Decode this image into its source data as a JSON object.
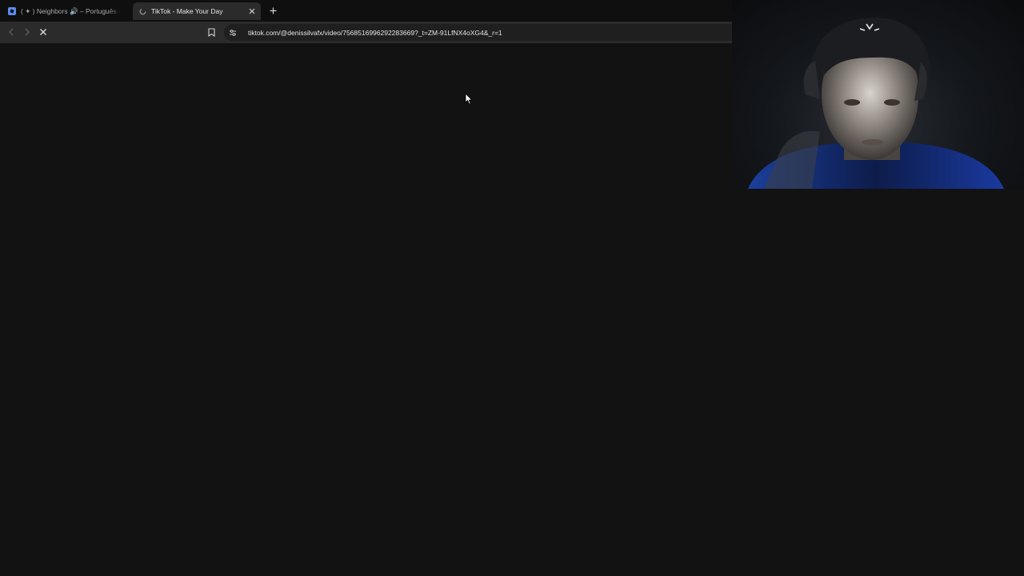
{
  "browser": {
    "tabs": [
      {
        "title": "( ✦ ) Neighbors 🔊 – Português - Roblox",
        "active": false,
        "favicon": "roblox-icon"
      },
      {
        "title": "TikTok - Make Your Day",
        "active": true,
        "favicon": "loading-spinner-icon"
      }
    ],
    "address_bar": {
      "url": "tiktok.com/@denissilvafx/video/7568516996292283669?_t=ZM-91LfNX4oXG4&_r=1"
    },
    "icons": {
      "back": "back-arrow-icon",
      "forward": "forward-arrow-icon",
      "stop": "stop-loading-icon",
      "bookmark": "bookmark-icon",
      "site_info": "tune-icon",
      "new_tab": "plus-icon",
      "close_tab": "close-icon"
    }
  },
  "page": {
    "state": "loading",
    "background_color": "#121212"
  },
  "overlay": {
    "webcam": "webcam-feed"
  }
}
